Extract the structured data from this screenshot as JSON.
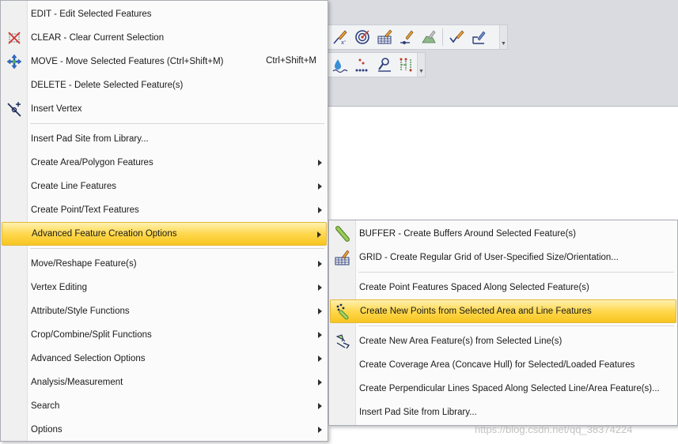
{
  "main_menu": {
    "items": [
      {
        "label": "EDIT - Edit Selected Features",
        "icon": "none",
        "has_submenu": false
      },
      {
        "label": "CLEAR - Clear Current Selection",
        "icon": "clear-selection-icon",
        "has_submenu": false
      },
      {
        "label": "MOVE - Move Selected Features (Ctrl+Shift+M)",
        "shortcut": "Ctrl+Shift+M",
        "icon": "move-icon",
        "has_submenu": false
      },
      {
        "label": "DELETE - Delete Selected Feature(s)",
        "icon": "none",
        "has_submenu": false
      },
      {
        "label": "Insert Vertex",
        "icon": "insert-vertex-icon",
        "has_submenu": false
      },
      {
        "label": "Insert Pad Site from Library...",
        "has_submenu": false
      },
      {
        "label": "Create Area/Polygon Features",
        "has_submenu": true
      },
      {
        "label": "Create Line Features",
        "has_submenu": true
      },
      {
        "label": "Create Point/Text Features",
        "has_submenu": true
      },
      {
        "label": "Advanced Feature Creation Options",
        "has_submenu": true,
        "highlighted": true
      },
      {
        "label": "Move/Reshape Feature(s)",
        "has_submenu": true
      },
      {
        "label": "Vertex Editing",
        "has_submenu": true
      },
      {
        "label": "Attribute/Style Functions",
        "has_submenu": true
      },
      {
        "label": "Crop/Combine/Split Functions",
        "has_submenu": true
      },
      {
        "label": "Advanced Selection Options",
        "has_submenu": true
      },
      {
        "label": "Analysis/Measurement",
        "has_submenu": true
      },
      {
        "label": "Search",
        "has_submenu": true
      },
      {
        "label": "Options",
        "has_submenu": true
      }
    ]
  },
  "sub_menu": {
    "items": [
      {
        "label": "BUFFER - Create Buffers Around Selected Feature(s)",
        "icon": "buffer-icon"
      },
      {
        "label": "GRID - Create Regular Grid of User-Specified Size/Orientation...",
        "icon": "grid-icon"
      },
      {
        "label": "Create Point Features Spaced Along Selected Feature(s)"
      },
      {
        "label": "Create New Points from Selected Area and Line Features",
        "icon": "points-from-features-icon",
        "highlighted": true
      },
      {
        "label": "Create New Area Feature(s) from Selected Line(s)",
        "icon": "area-from-lines-icon"
      },
      {
        "label": "Create Coverage Area (Concave Hull) for Selected/Loaded Features"
      },
      {
        "label": "Create Perpendicular Lines Spaced Along Selected Line/Area Feature(s)..."
      },
      {
        "label": "Insert Pad Site from Library..."
      }
    ]
  },
  "watermark": "https://blog.csdn.net/qq_38374224",
  "colors": {
    "highlight_top": "#fff1b0",
    "highlight_bottom": "#f7c520",
    "highlight_border": "#e3b83a",
    "menu_bg": "#fbfbfb",
    "gutter_bg": "#f0f0f0",
    "app_bg": "#d9dbe0"
  }
}
